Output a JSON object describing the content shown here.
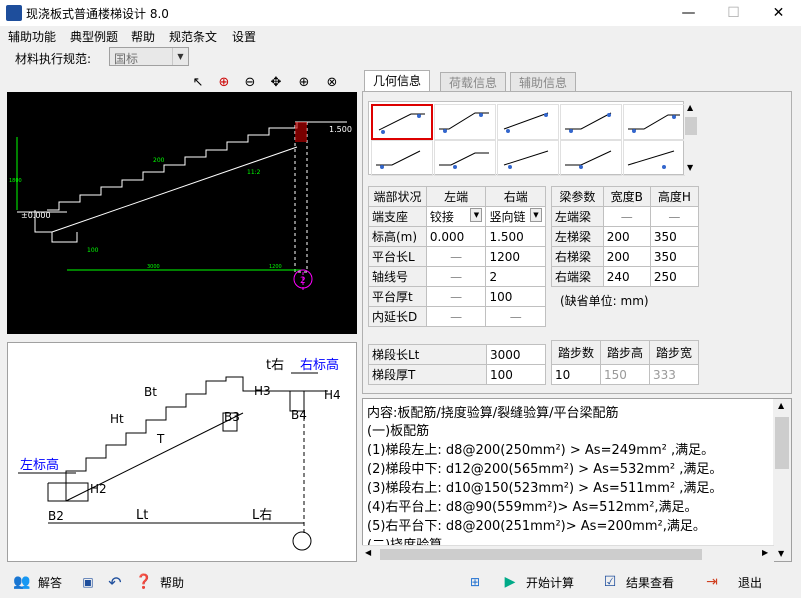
{
  "window": {
    "title": "现浇板式普通楼梯设计 8.0",
    "min": "—",
    "max": "☐",
    "close": "✕"
  },
  "menu": [
    "辅助功能",
    "典型例题",
    "帮助",
    "规范条文",
    "设置"
  ],
  "spec": {
    "label": "材料执行规范:",
    "value": "国标"
  },
  "cad_tools": [
    "pointer-icon",
    "zoom-window-icon",
    "zoom-out-icon",
    "pan-icon",
    "zoom-in-icon",
    "zoom-extents-icon"
  ],
  "cad": {
    "labels": {
      "top_right": "1.500",
      "left_level": "±0.000",
      "t1": "200",
      "t2": "100",
      "axis": "2",
      "ratio": "11:2",
      "dim_bottom": "3000",
      "dim_right": "1200",
      "dim_left": "1800"
    }
  },
  "sketch": {
    "t_right": "t右",
    "right_elev": "右标高",
    "left_elev": "左标高",
    "bt": "Bt",
    "ht": "Ht",
    "t": "T",
    "h2": "H2",
    "h3": "H3",
    "h4": "H4",
    "b2": "B2",
    "b3": "B3",
    "b4": "B4",
    "lt": "Lt",
    "lright": "L右"
  },
  "tabs": [
    "几何信息",
    "荷载信息",
    "辅助信息"
  ],
  "ends_table": {
    "headers": [
      "端部状况",
      "左端",
      "右端"
    ],
    "rows": [
      {
        "label": "端支座",
        "left": "铰接",
        "right": "竖向链"
      },
      {
        "label": "标高(m)",
        "left": "0.000",
        "right": "1.500"
      },
      {
        "label": "平台长L",
        "left": "—",
        "right": "1200"
      },
      {
        "label": "轴线号",
        "left": "—",
        "right": "2"
      },
      {
        "label": "平台厚t",
        "left": "—",
        "right": "100"
      },
      {
        "label": "内延长D",
        "left": "—",
        "right": "—"
      }
    ]
  },
  "beam_table": {
    "headers": [
      "梁参数",
      "宽度B",
      "高度H"
    ],
    "rows": [
      {
        "label": "左端梁",
        "b": "—",
        "h": "—"
      },
      {
        "label": "左梯梁",
        "b": "200",
        "h": "350"
      },
      {
        "label": "右梯梁",
        "b": "200",
        "h": "350"
      },
      {
        "label": "右端梁",
        "b": "240",
        "h": "250"
      }
    ],
    "unit_note": "(缺省单位: mm)"
  },
  "flight_table": {
    "rows": [
      {
        "label": "梯段长Lt",
        "value": "3000"
      },
      {
        "label": "梯段厚T",
        "value": "100"
      }
    ]
  },
  "step_table": {
    "headers": [
      "踏步数",
      "踏步高",
      "踏步宽"
    ],
    "values": [
      "10",
      "150",
      "333"
    ]
  },
  "result_lines": [
    "内容:板配筋/挠度验算/裂缝验算/平台梁配筋",
    "(一)板配筋",
    "(1)梯段左上: d8@200(250mm²) > As=249mm² ,满足。",
    "(2)梯段中下: d12@200(565mm²) > As=532mm² ,满足。",
    "(3)梯段右上: d10@150(523mm²) > As=511mm² ,满足。",
    "(4)右平台上: d8@90(559mm²)> As=512mm²,满足。",
    "(5)右平台下: d8@200(251mm²)> As=200mm²,满足。",
    "(二)挠度验算"
  ],
  "bottom": {
    "answer": "解答",
    "help": "帮助",
    "start": "开始计算",
    "view": "结果查看",
    "exit": "退出"
  }
}
